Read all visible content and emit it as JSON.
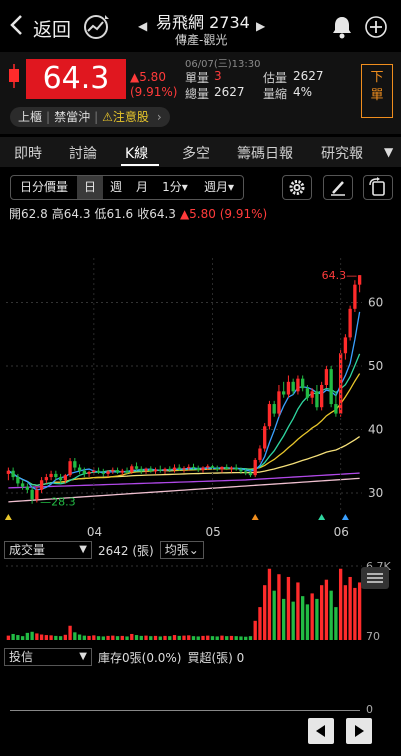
{
  "header": {
    "back_label": "返回",
    "stock_title": "易飛網 2734",
    "sector": "傳產-觀光"
  },
  "quote": {
    "price": "64.3",
    "change": "▲5.80",
    "change_pct": "(9.91%)",
    "timestamp": "06/07(三)13:30",
    "unit_volume_label": "單量",
    "unit_volume": "3",
    "total_volume_label": "總量",
    "total_volume": "2627",
    "est_volume_label": "估量",
    "est_volume": "2627",
    "vol_shrink_label": "量縮",
    "vol_shrink": "4%",
    "order_button": "下單",
    "tags": [
      "上櫃",
      "禁當沖",
      "⚠注意股"
    ]
  },
  "tabs": [
    "即時",
    "討論",
    "K線",
    "多空",
    "籌碼日報",
    "研究報"
  ],
  "active_tab": "K線",
  "toolbar": {
    "price_volume": "日分價量",
    "periods": [
      "日",
      "週",
      "月"
    ],
    "selected_period": "日",
    "minute": "1分▾",
    "week_month": "週月▾"
  },
  "ohlc": {
    "open": "開62.8",
    "high": "高64.3",
    "low": "低61.6",
    "close": "收64.3",
    "change": "▲5.80 (9.91%)"
  },
  "chart_data": {
    "type": "candlestick",
    "y_ticks": [
      "60",
      "50",
      "40",
      "30"
    ],
    "ylim": [
      27,
      67
    ],
    "x_ticks": [
      "04",
      "05",
      "06"
    ],
    "high_label": "64.3",
    "low_label": "28.3",
    "colors": {
      "up": "#ff2b2b",
      "down": "#22bb44",
      "ma5": "#3aa0ff",
      "ma10": "#2fd6a0",
      "ma20": "#e8c62b",
      "ma60": "#f5e07a",
      "ma120": "#b048e8",
      "ma240": "#f0c0d0"
    },
    "candles": [
      [
        33,
        34,
        32,
        33.5
      ],
      [
        33.5,
        34,
        32,
        32.5
      ],
      [
        32.5,
        33,
        31,
        31.5
      ],
      [
        31.5,
        32,
        30.5,
        31
      ],
      [
        31,
        31.5,
        30,
        30.5
      ],
      [
        30.5,
        31,
        28.3,
        29
      ],
      [
        29,
        31,
        28.5,
        30.5
      ],
      [
        30.5,
        32.5,
        30,
        32
      ],
      [
        32,
        33,
        31.5,
        32.5
      ],
      [
        32.5,
        33.5,
        32,
        33
      ],
      [
        33,
        33.5,
        32,
        32.5
      ],
      [
        32.5,
        33,
        31.5,
        32
      ],
      [
        32,
        33,
        31.5,
        32.8
      ],
      [
        32.8,
        35.5,
        32.5,
        35
      ],
      [
        35,
        35.5,
        33.5,
        34
      ],
      [
        34,
        34.5,
        33,
        33.5
      ],
      [
        33.5,
        34,
        32.5,
        33
      ],
      [
        33,
        33.5,
        32.5,
        33.3
      ],
      [
        33.3,
        34,
        32.8,
        33.5
      ],
      [
        33.5,
        34,
        33,
        33.2
      ],
      [
        33.2,
        33.8,
        32.6,
        33
      ],
      [
        33,
        33.6,
        32.5,
        33.4
      ],
      [
        33.4,
        34,
        33,
        33.6
      ],
      [
        33.6,
        34,
        33,
        33.2
      ],
      [
        33.2,
        33.8,
        32.8,
        33.5
      ],
      [
        33.5,
        34,
        33,
        33.3
      ],
      [
        33.3,
        34.5,
        33,
        34.2
      ],
      [
        34.2,
        34.8,
        33.5,
        33.8
      ],
      [
        33.8,
        34.2,
        33,
        33.5
      ],
      [
        33.5,
        34,
        33,
        33.8
      ],
      [
        33.8,
        34.2,
        33.2,
        33.4
      ],
      [
        33.4,
        34,
        33,
        33.7
      ],
      [
        33.7,
        34.3,
        33.2,
        33.5
      ],
      [
        33.5,
        34,
        33,
        33.8
      ],
      [
        33.8,
        34.2,
        33.3,
        33.6
      ],
      [
        33.6,
        34.5,
        33.2,
        34
      ],
      [
        34,
        34.5,
        33.5,
        33.7
      ],
      [
        33.7,
        34.2,
        33.2,
        33.9
      ],
      [
        33.9,
        34.5,
        33.5,
        34.1
      ],
      [
        34.1,
        34.6,
        33.7,
        33.9
      ],
      [
        33.9,
        34.3,
        33.3,
        33.6
      ],
      [
        33.6,
        34.2,
        33.2,
        34
      ],
      [
        34,
        34.5,
        33.6,
        34.2
      ],
      [
        34.2,
        34.6,
        33.8,
        33.9
      ],
      [
        33.9,
        34.3,
        33.4,
        33.7
      ],
      [
        33.7,
        34.2,
        33.2,
        34.1
      ],
      [
        34.1,
        34.5,
        33.6,
        33.8
      ],
      [
        33.8,
        34.2,
        33.2,
        34
      ],
      [
        34,
        34.5,
        33.5,
        33.7
      ],
      [
        33.7,
        34,
        33,
        33.4
      ],
      [
        33.4,
        33.8,
        32.8,
        33.2
      ],
      [
        33.2,
        33.6,
        32.5,
        32.8
      ],
      [
        32.8,
        35.5,
        32.5,
        35.2
      ],
      [
        35.2,
        37.5,
        34.8,
        37
      ],
      [
        37,
        41,
        36.5,
        40.5
      ],
      [
        40.5,
        44.5,
        40,
        44
      ],
      [
        44,
        44.5,
        42,
        42.5
      ],
      [
        42.5,
        47,
        42,
        46
      ],
      [
        46,
        47.5,
        45,
        45.5
      ],
      [
        45.5,
        48.5,
        45,
        47.5
      ],
      [
        47.5,
        48,
        45.5,
        46
      ],
      [
        46,
        48.5,
        45.5,
        48
      ],
      [
        48,
        48.5,
        46,
        46.5
      ],
      [
        46.5,
        47,
        44.5,
        45
      ],
      [
        45,
        46.5,
        44,
        46
      ],
      [
        46,
        47,
        43,
        43.5
      ],
      [
        43.5,
        47.5,
        43,
        47
      ],
      [
        47,
        50,
        46.5,
        49.5
      ],
      [
        49.5,
        50,
        43.5,
        44
      ],
      [
        44,
        46,
        42,
        42.5
      ],
      [
        42.5,
        52.5,
        42,
        52
      ],
      [
        52,
        55,
        51,
        54.5
      ],
      [
        54.5,
        59.5,
        54,
        59
      ],
      [
        59,
        63.5,
        58.5,
        62.8
      ],
      [
        62.8,
        64.3,
        61.6,
        64.3
      ]
    ],
    "volume_ticks": [
      "6.7K",
      "70",
      "0"
    ],
    "volumes": [
      160,
      220,
      180,
      140,
      260,
      300,
      240,
      200,
      180,
      170,
      150,
      140,
      190,
      520,
      280,
      200,
      160,
      150,
      170,
      140,
      130,
      150,
      160,
      140,
      150,
      130,
      220,
      180,
      150,
      160,
      140,
      150,
      130,
      150,
      140,
      180,
      150,
      160,
      170,
      140,
      130,
      150,
      160,
      140,
      130,
      160,
      140,
      150,
      140,
      130,
      120,
      140,
      700,
      1200,
      2000,
      2600,
      1800,
      2400,
      1500,
      2300,
      1400,
      2100,
      1600,
      1300,
      1700,
      1500,
      2000,
      2200,
      1800,
      1200,
      2600,
      2000,
      2300,
      1900,
      2100
    ]
  },
  "volume_panel": {
    "indicator": "成交量",
    "value": "2642 (張)",
    "ma_mode": "均張"
  },
  "investor_panel": {
    "indicator": "投信",
    "inventory": "庫存0張(0.0%)",
    "overbought": "買超(張) 0",
    "axis_zero": "0"
  }
}
